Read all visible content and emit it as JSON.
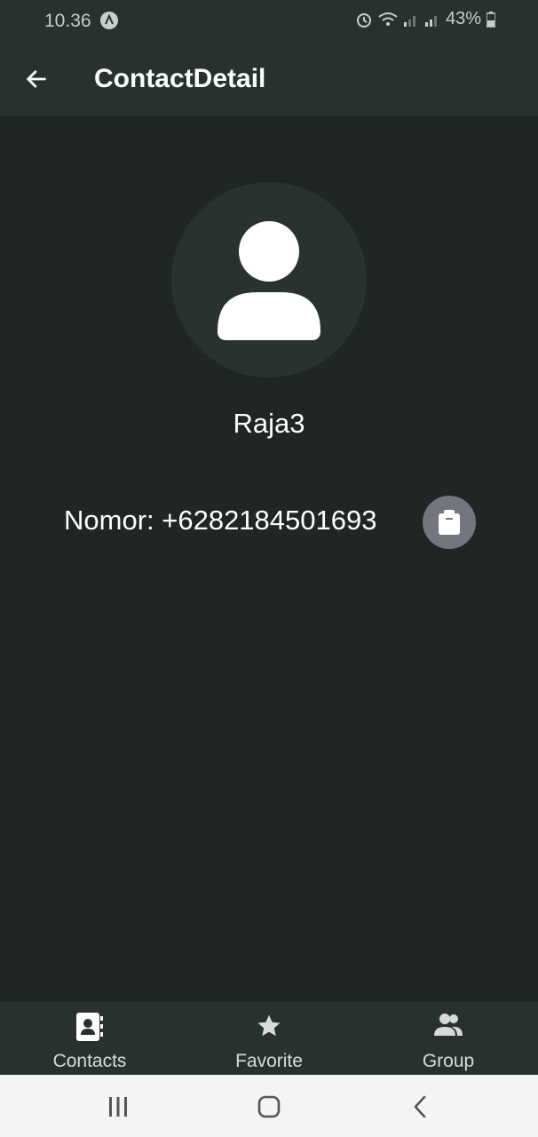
{
  "status_bar": {
    "time": "10.36",
    "battery": "43%"
  },
  "app_bar": {
    "title": "ContactDetail"
  },
  "contact": {
    "name": "Raja3",
    "phone_line": "Nomor: +6282184501693"
  },
  "bottom_nav": {
    "items": [
      {
        "label": "Contacts",
        "icon": "contact-book-icon"
      },
      {
        "label": "Favorite",
        "icon": "star-icon"
      },
      {
        "label": "Group",
        "icon": "group-icon"
      }
    ]
  },
  "colors": {
    "background": "#1f2624",
    "bar": "#293130",
    "avatar_bg": "#29322f",
    "copy_button": "#73767f"
  }
}
